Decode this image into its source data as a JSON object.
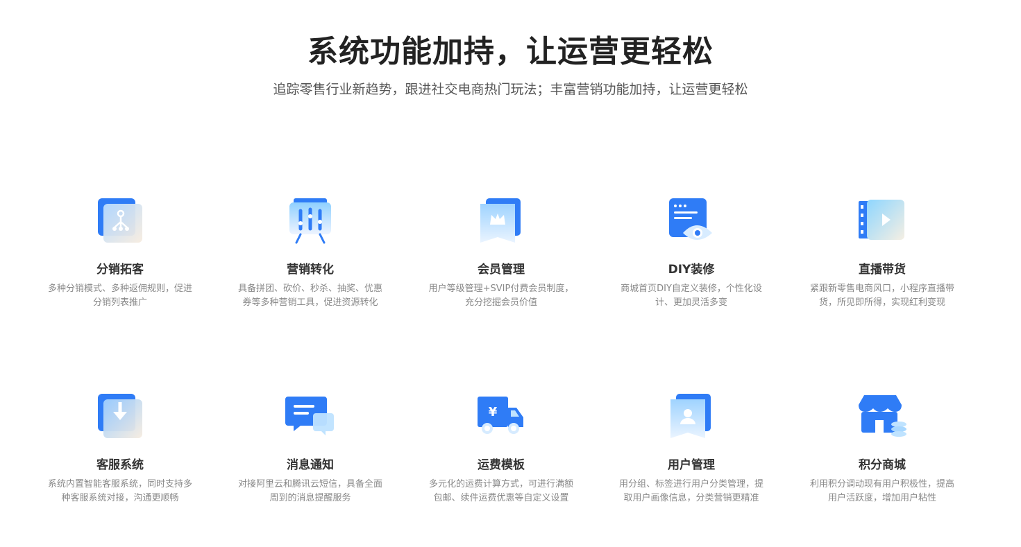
{
  "header": {
    "title": "系统功能加持，让运营更轻松",
    "subtitle": "追踪零售行业新趋势，跟进社交电商热门玩法；丰富营销功能加持，让运营更轻松"
  },
  "features": [
    {
      "title": "分销拓客",
      "desc": "多种分销模式、多种返佣规则，促进分销列表推广",
      "icon": "distribution-icon"
    },
    {
      "title": "营销转化",
      "desc": "具备拼团、砍价、秒杀、抽奖、优惠券等多种营销工具，促进资源转化",
      "icon": "marketing-icon"
    },
    {
      "title": "会员管理",
      "desc": "用户等级管理+SVIP付费会员制度，充分挖掘会员价值",
      "icon": "crown-icon"
    },
    {
      "title": "DIY装修",
      "desc": "商城首页DIY自定义装修，个性化设计、更加灵活多变",
      "icon": "diy-eye-icon"
    },
    {
      "title": "直播带货",
      "desc": "紧跟新零售电商风口，小程序直播带货，所见即所得，实现红利变现",
      "icon": "live-play-icon"
    },
    {
      "title": "客服系统",
      "desc": "系统内置智能客服系统，同时支持多种客服系统对接，沟通更顺畅",
      "icon": "download-arrow-icon"
    },
    {
      "title": "消息通知",
      "desc": "对接阿里云和腾讯云短信，具备全面周到的消息提醒服务",
      "icon": "message-bubble-icon"
    },
    {
      "title": "运费模板",
      "desc": "多元化的运费计算方式，可进行满额包邮、续件运费优惠等自定义设置",
      "icon": "delivery-truck-icon"
    },
    {
      "title": "用户管理",
      "desc": "用分组、标签进行用户分类管理，提取用户画像信息，分类营销更精准",
      "icon": "user-badge-icon"
    },
    {
      "title": "积分商城",
      "desc": "利用积分调动现有用户积极性，提高用户活跃度，增加用户粘性",
      "icon": "store-coins-icon"
    }
  ],
  "colors": {
    "accent": "#2f7cf6",
    "light": "#cfe6ff"
  }
}
